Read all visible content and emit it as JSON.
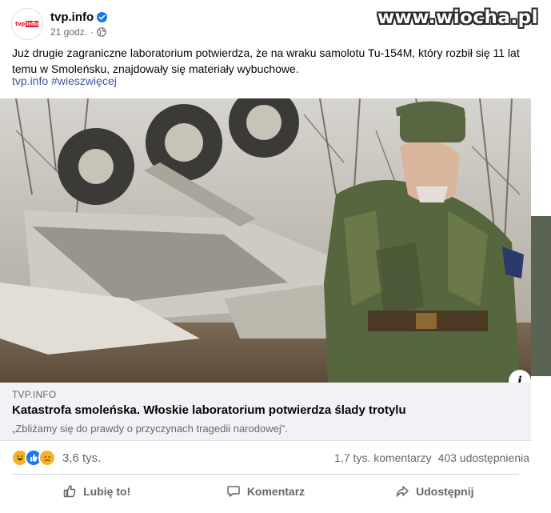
{
  "watermark": "www.wiocha.pl",
  "page": {
    "name": "tvp.info",
    "avatar_text_a": "tvp",
    "avatar_text_b": "info",
    "time": "21 godz.",
    "dot": "·"
  },
  "post": {
    "text": "Już drugie zagraniczne laboratorium potwierdza, że na wraku samolotu Tu-154M, który rozbił się 11 lat temu w Smoleńsku, znajdowały się materiały wybuchowe.",
    "hashtag_1": "tvp.info",
    "hashtag_2": "#wieszwięcej"
  },
  "link": {
    "domain": "TVP.INFO",
    "title": "Katastrofa smoleńska. Włoskie laboratorium potwierdza ślady trotylu",
    "description": "„Zbliżamy się do prawdy o przyczynach tragedii narodowej”."
  },
  "info_button": "i",
  "reactions": {
    "icons": [
      "haha-icon",
      "like-icon",
      "sad-icon"
    ],
    "count": "3,6 tys."
  },
  "stats": {
    "comments": "1,7 tys. komentarzy",
    "shares": "403 udostępnienia"
  },
  "actions": {
    "like": "Lubię to!",
    "comment": "Komentarz",
    "share": "Udostępnij"
  },
  "colors": {
    "accent": "#1877f2",
    "link": "#385898",
    "muted": "#65676b",
    "preview_bg": "#f0f2f5",
    "tvp_red": "#e0162b"
  }
}
